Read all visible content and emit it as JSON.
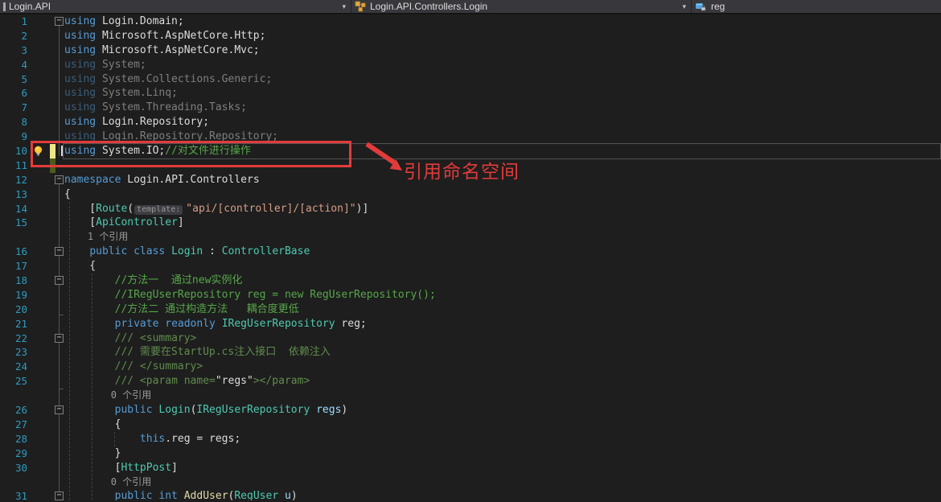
{
  "navbar": {
    "project": "Login.API",
    "type": "Login.API.Controllers.Login",
    "member": "reg",
    "dropdown_glyph": "▾"
  },
  "annotation": {
    "label": "引用命名空间"
  },
  "colors": {
    "annotation_red": "#E23B3B",
    "change_unsaved": "#EDE78A",
    "change_saved": "#4E5B1E",
    "keyword": "#569CD6",
    "type": "#4EC9B0",
    "comment": "#57A64A",
    "line_number": "#2E9BBF"
  },
  "editor": {
    "fold_glyph": "−",
    "rows": [
      {
        "num": "1",
        "fold": true,
        "tokens": [
          [
            "kw",
            "using"
          ],
          [
            "pl",
            " Login.Domain;"
          ]
        ]
      },
      {
        "num": "2",
        "tokens": [
          [
            "kw",
            "using"
          ],
          [
            "pl",
            " Microsoft.AspNetCore.Http;"
          ]
        ]
      },
      {
        "num": "3",
        "tokens": [
          [
            "kw",
            "using"
          ],
          [
            "pl",
            " Microsoft.AspNetCore.Mvc;"
          ]
        ]
      },
      {
        "num": "4",
        "faded": true,
        "tokens": [
          [
            "kw",
            "using"
          ],
          [
            "pl",
            " System;"
          ]
        ]
      },
      {
        "num": "5",
        "faded": true,
        "tokens": [
          [
            "kw",
            "using"
          ],
          [
            "pl",
            " System.Collections.Generic;"
          ]
        ]
      },
      {
        "num": "6",
        "faded": true,
        "tokens": [
          [
            "kw",
            "using"
          ],
          [
            "pl",
            " System.Linq;"
          ]
        ]
      },
      {
        "num": "7",
        "faded": true,
        "tokens": [
          [
            "kw",
            "using"
          ],
          [
            "pl",
            " System.Threading.Tasks;"
          ]
        ]
      },
      {
        "num": "8",
        "tokens": [
          [
            "kw",
            "using"
          ],
          [
            "pl",
            " Login.Repository;"
          ]
        ]
      },
      {
        "num": "9",
        "faded": true,
        "tokens": [
          [
            "kw",
            "using"
          ],
          [
            "pl",
            " Login.Repository.Repository;"
          ]
        ]
      },
      {
        "num": "10",
        "bulb": true,
        "caret": true,
        "changebar": "unsaved",
        "tokens": [
          [
            "kw",
            "using"
          ],
          [
            "pl",
            " System.IO;"
          ],
          [
            "cm",
            "//对文件进行操作"
          ]
        ]
      },
      {
        "num": "11",
        "changebar": "saved",
        "tokens": []
      },
      {
        "num": "12",
        "fold": true,
        "tokens": [
          [
            "kw",
            "namespace"
          ],
          [
            "pl",
            " Login.API.Controllers"
          ]
        ]
      },
      {
        "num": "13",
        "tokens": [
          [
            "pl",
            "{"
          ]
        ]
      },
      {
        "num": "14",
        "tokens": [
          [
            "pl",
            "    ["
          ],
          [
            "ty",
            "Route"
          ],
          [
            "pl",
            "("
          ],
          [
            "hint",
            "template:"
          ],
          [
            "st",
            "\"api/[controller]/[action]\""
          ],
          [
            "pl",
            ")]"
          ]
        ]
      },
      {
        "num": "15",
        "tokens": [
          [
            "pl",
            "    ["
          ],
          [
            "ty",
            "ApiController"
          ],
          [
            "pl",
            "]"
          ]
        ]
      },
      {
        "lens": true,
        "tokens": [
          [
            "lens",
            "    1 个引用"
          ]
        ]
      },
      {
        "num": "16",
        "fold": true,
        "tokens": [
          [
            "pl",
            "    "
          ],
          [
            "kw",
            "public"
          ],
          [
            "pl",
            " "
          ],
          [
            "kw",
            "class"
          ],
          [
            "pl",
            " "
          ],
          [
            "ty",
            "Login"
          ],
          [
            "pl",
            " : "
          ],
          [
            "ty",
            "ControllerBase"
          ]
        ]
      },
      {
        "num": "17",
        "tokens": [
          [
            "pl",
            "    {"
          ]
        ]
      },
      {
        "num": "18",
        "fold": true,
        "tokens": [
          [
            "pl",
            "        "
          ],
          [
            "cm",
            "//方法一  通过new实例化"
          ]
        ]
      },
      {
        "num": "19",
        "tokens": [
          [
            "pl",
            "        "
          ],
          [
            "cm",
            "//IRegUserRepository reg = new RegUserRepository();"
          ]
        ]
      },
      {
        "num": "20",
        "tokens": [
          [
            "pl",
            "        "
          ],
          [
            "cm",
            "//方法二 通过构造方法   耦合度更低"
          ]
        ]
      },
      {
        "num": "21",
        "tokens": [
          [
            "pl",
            "        "
          ],
          [
            "kw",
            "private"
          ],
          [
            "pl",
            " "
          ],
          [
            "kw",
            "readonly"
          ],
          [
            "pl",
            " "
          ],
          [
            "ty",
            "IRegUserRepository"
          ],
          [
            "pl",
            " reg;"
          ]
        ]
      },
      {
        "num": "22",
        "fold": true,
        "tokens": [
          [
            "pl",
            "        "
          ],
          [
            "dc",
            "/// <summary>"
          ]
        ]
      },
      {
        "num": "23",
        "tokens": [
          [
            "pl",
            "        "
          ],
          [
            "dc",
            "/// 需要在StartUp.cs注入接口  依赖注入"
          ]
        ]
      },
      {
        "num": "24",
        "tokens": [
          [
            "pl",
            "        "
          ],
          [
            "dc",
            "/// </summary>"
          ]
        ]
      },
      {
        "num": "25",
        "tokens": [
          [
            "pl",
            "        "
          ],
          [
            "dc",
            "/// <param name="
          ],
          [
            "pl",
            "\"regs\""
          ],
          [
            "dc",
            "></param>"
          ]
        ]
      },
      {
        "lens": true,
        "tokens": [
          [
            "lens",
            "        0 个引用"
          ]
        ]
      },
      {
        "num": "26",
        "fold": true,
        "tokens": [
          [
            "pl",
            "        "
          ],
          [
            "kw",
            "public"
          ],
          [
            "pl",
            " "
          ],
          [
            "ty",
            "Login"
          ],
          [
            "pl",
            "("
          ],
          [
            "ty",
            "IRegUserRepository"
          ],
          [
            "pl",
            " "
          ],
          [
            "pr",
            "regs"
          ],
          [
            "pl",
            ")"
          ]
        ]
      },
      {
        "num": "27",
        "tokens": [
          [
            "pl",
            "        {"
          ]
        ]
      },
      {
        "num": "28",
        "tokens": [
          [
            "pl",
            "            "
          ],
          [
            "kw",
            "this"
          ],
          [
            "pl",
            ".reg = regs;"
          ]
        ]
      },
      {
        "num": "29",
        "tokens": [
          [
            "pl",
            "        }"
          ]
        ]
      },
      {
        "num": "30",
        "tokens": [
          [
            "pl",
            "        ["
          ],
          [
            "ty",
            "HttpPost"
          ],
          [
            "pl",
            "]"
          ]
        ]
      },
      {
        "lens": true,
        "tokens": [
          [
            "lens",
            "        0 个引用"
          ]
        ]
      },
      {
        "num": "31",
        "fold": true,
        "tokens": [
          [
            "pl",
            "        "
          ],
          [
            "kw",
            "public"
          ],
          [
            "pl",
            " "
          ],
          [
            "kw",
            "int"
          ],
          [
            "pl",
            " "
          ],
          [
            "me",
            "AddUser"
          ],
          [
            "pl",
            "("
          ],
          [
            "ty",
            "RegUser"
          ],
          [
            "pl",
            " "
          ],
          [
            "pr",
            "u"
          ],
          [
            "pl",
            ")"
          ]
        ]
      }
    ]
  }
}
